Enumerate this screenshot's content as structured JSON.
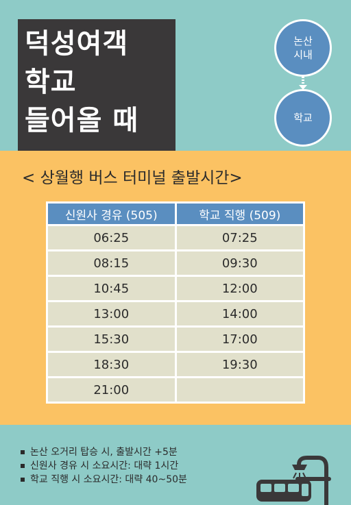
{
  "title": {
    "lines": [
      "덕성여객",
      "학교",
      "들어올 때"
    ]
  },
  "route": {
    "from": [
      "논산",
      "시내"
    ],
    "to": "학교"
  },
  "subtitle": "< 상월행 버스 터미널 출발시간>",
  "schedule": {
    "headers": [
      "신원사 경유 (505)",
      "학교 직행 (509)"
    ],
    "rows": [
      [
        "06:25",
        "07:25"
      ],
      [
        "08:15",
        "09:30"
      ],
      [
        "10:45",
        "12:00"
      ],
      [
        "13:00",
        "14:00"
      ],
      [
        "15:30",
        "17:00"
      ],
      [
        "18:30",
        "19:30"
      ],
      [
        "21:00",
        ""
      ]
    ]
  },
  "notes": [
    "논산 오거리 탑승 시, 출발시간 +5분",
    "신원사 경유 시 소요시간: 대략 1시간",
    "학교 직행 시 소요시간: 대략 40~50분"
  ],
  "icons": {
    "bus": "bus-stop-icon",
    "arrow": "arrow-down-icon"
  },
  "colors": {
    "teal": "#8ecbc7",
    "dark": "#3a3839",
    "blue": "#5a8ec0",
    "orange": "#fbc263",
    "cell": "#e1e0cb"
  }
}
